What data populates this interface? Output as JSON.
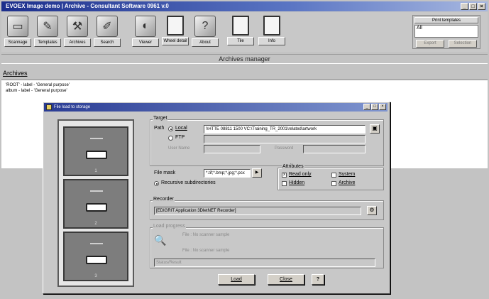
{
  "window": {
    "title": "EVOEX Image demo | Archive - Consultant Software 0961 v.0",
    "buttons": [
      "_",
      "□",
      "×"
    ]
  },
  "toolbar": {
    "tools": [
      {
        "name": "scanner-icon",
        "glyph": "▭",
        "label": "Scannage"
      },
      {
        "name": "templates-icon",
        "glyph": "✎",
        "label": "Templates"
      },
      {
        "name": "archives-icon",
        "glyph": "⚒",
        "label": "Archives"
      },
      {
        "name": "search-icon",
        "glyph": "✐",
        "label": "Search"
      },
      {
        "name": "viewer-icon",
        "glyph": "◐",
        "label": "Viewer"
      },
      {
        "name": "document-icon",
        "glyph": "",
        "label": "Wheel detail"
      },
      {
        "name": "help-icon",
        "glyph": "?",
        "label": "About"
      },
      {
        "name": "document-icon",
        "glyph": "",
        "label": "Tile"
      },
      {
        "name": "document-icon",
        "glyph": "",
        "label": "Info"
      }
    ]
  },
  "print_panel": {
    "header": "Print templates",
    "selected": "All",
    "btn1": "Export",
    "btn2": "Selection"
  },
  "mode_title": "Archives manager",
  "archives_header": "Archives",
  "archives_list": [
    "'ROOT' - label - 'General purpose'",
    "album - label - 'General purpose'"
  ],
  "dialog": {
    "title": "File load to storage",
    "target_label": "Target",
    "path_label": "Path",
    "local_label": "Local",
    "path_value": "\\\\HTTE 08811 1500 VC:\\Training_TR_2001\\related\\artwork",
    "ftp_label": "FTP",
    "user_name_label": "User Name",
    "password_label": "Password",
    "file_mask_label": "File mask",
    "file_mask_value": "*.tif;*.bmp;*.jpg;*.pcx",
    "recursive_label": "Recursive subdirectories",
    "attributes_label": "Attributes",
    "attributes": [
      "Read only",
      "System",
      "Hidden",
      "Archive"
    ],
    "recorder_label": "Recorder",
    "recorder_value": "[EDIGRIT Application 3DIetNET Recorder]",
    "load_progress_label": "Load progress",
    "file_line1": "File : No scanner sample",
    "file_line2": "File : No scanner sample",
    "status_label": "Status/Result",
    "load_button": "Load",
    "close_button": "Close",
    "help_button": "?",
    "drawer_numbers": [
      "1",
      "2",
      "3"
    ]
  }
}
